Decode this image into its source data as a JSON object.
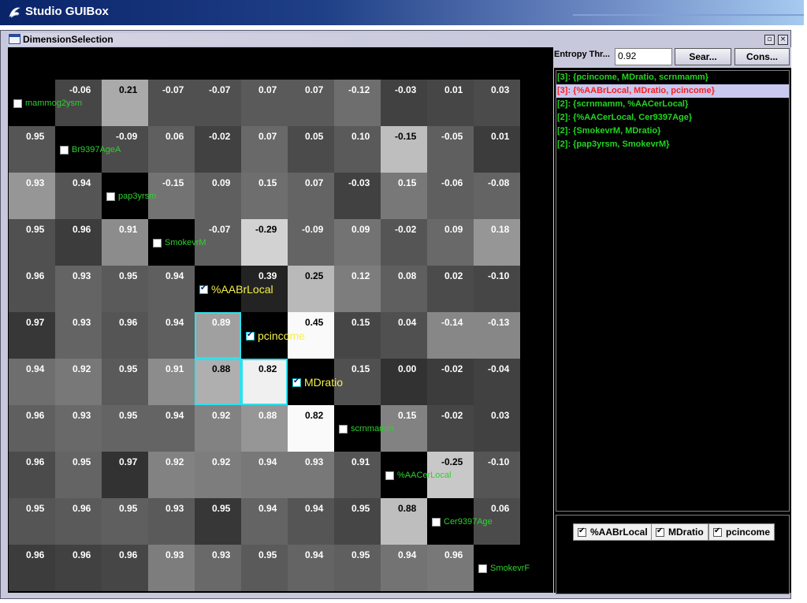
{
  "app": {
    "title": "Studio GUIBox",
    "icon": "studio-swirl-icon"
  },
  "frame": {
    "title": "DimensionSelection",
    "icon": "window-icon",
    "buttons": [
      "maximize-icon",
      "close-icon"
    ]
  },
  "matrix": {
    "dimensions": [
      {
        "name": "mammog2ysm",
        "checked": false
      },
      {
        "name": "Br9397AgeA",
        "checked": false
      },
      {
        "name": "pap3yrsm",
        "checked": false
      },
      {
        "name": "SmokevrM",
        "checked": false
      },
      {
        "name": "%AABrLocal",
        "checked": true
      },
      {
        "name": "pcincome",
        "checked": true
      },
      {
        "name": "MDratio",
        "checked": true
      },
      {
        "name": "scrnmamm",
        "checked": false
      },
      {
        "name": "%AACerLocal",
        "checked": false
      },
      {
        "name": "Cer9397Age",
        "checked": false
      },
      {
        "name": "SmokevrF",
        "checked": false
      }
    ],
    "values": [
      [
        null,
        "-0.06",
        "0.21",
        "-0.07",
        "-0.07",
        "0.07",
        "0.07",
        "-0.12",
        "-0.03",
        "0.01",
        "0.03"
      ],
      [
        "0.95",
        null,
        "-0.09",
        "0.06",
        "-0.02",
        "0.07",
        "0.05",
        "0.10",
        "-0.15",
        "-0.05",
        "0.01"
      ],
      [
        "0.93",
        "0.94",
        null,
        "-0.15",
        "0.09",
        "0.15",
        "0.07",
        "-0.03",
        "0.15",
        "-0.06",
        "-0.08"
      ],
      [
        "0.95",
        "0.96",
        "0.91",
        null,
        "-0.07",
        "-0.29",
        "-0.09",
        "0.09",
        "-0.02",
        "0.09",
        "0.18"
      ],
      [
        "0.96",
        "0.93",
        "0.95",
        "0.94",
        null,
        "0.39",
        "0.25",
        "0.12",
        "0.08",
        "0.02",
        "-0.10"
      ],
      [
        "0.97",
        "0.93",
        "0.96",
        "0.94",
        "0.89",
        null,
        "0.45",
        "0.15",
        "0.04",
        "-0.14",
        "-0.13"
      ],
      [
        "0.94",
        "0.92",
        "0.95",
        "0.91",
        "0.88",
        "0.82",
        null,
        "0.15",
        "0.00",
        "-0.02",
        "-0.04"
      ],
      [
        "0.96",
        "0.93",
        "0.95",
        "0.94",
        "0.92",
        "0.88",
        "0.82",
        null,
        "0.15",
        "-0.02",
        "0.03"
      ],
      [
        "0.96",
        "0.95",
        "0.97",
        "0.92",
        "0.92",
        "0.94",
        "0.93",
        "0.91",
        null,
        "-0.25",
        "-0.10"
      ],
      [
        "0.95",
        "0.96",
        "0.95",
        "0.93",
        "0.95",
        "0.94",
        "0.94",
        "0.95",
        "0.88",
        null,
        "0.06"
      ],
      [
        "0.96",
        "0.96",
        "0.96",
        "0.93",
        "0.93",
        "0.95",
        "0.94",
        "0.95",
        "0.94",
        "0.96",
        null
      ]
    ],
    "shades": [
      [
        null,
        70,
        170,
        80,
        80,
        90,
        90,
        110,
        65,
        70,
        75
      ],
      [
        85,
        null,
        75,
        95,
        65,
        105,
        75,
        90,
        190,
        95,
        60
      ],
      [
        150,
        85,
        null,
        115,
        95,
        110,
        100,
        65,
        120,
        95,
        100
      ],
      [
        80,
        60,
        140,
        0,
        95,
        210,
        100,
        115,
        85,
        105,
        150
      ],
      [
        80,
        100,
        90,
        95,
        null,
        35,
        185,
        125,
        95,
        75,
        70
      ],
      [
        55,
        100,
        85,
        95,
        160,
        null,
        250,
        70,
        80,
        135,
        135
      ],
      [
        110,
        120,
        90,
        140,
        175,
        240,
        null,
        80,
        50,
        60,
        65
      ],
      [
        95,
        105,
        100,
        100,
        130,
        150,
        250,
        null,
        130,
        70,
        65
      ],
      [
        75,
        100,
        50,
        130,
        125,
        120,
        120,
        85,
        null,
        200,
        85
      ],
      [
        85,
        90,
        95,
        90,
        55,
        100,
        85,
        70,
        190,
        null,
        75
      ],
      [
        60,
        65,
        70,
        125,
        105,
        90,
        100,
        95,
        115,
        120,
        null
      ]
    ],
    "highlighted_cells": [
      [
        5,
        4
      ],
      [
        6,
        4
      ],
      [
        6,
        5
      ]
    ],
    "label_color": "#2fd12f",
    "checked_label_color": "#f5f04a",
    "highlight_color": "#2ee0ee"
  },
  "right": {
    "threshold_label": "Entropy Thr...",
    "threshold_value": "0.92",
    "search_button": "Sear...",
    "cons_button": "Cons...",
    "results": [
      {
        "text": "[3]: {pcincome, MDratio, scrnmamm}",
        "selected": false
      },
      {
        "text": "[3]: {%AABrLocal, MDratio, pcincome}",
        "selected": true
      },
      {
        "text": "[2]: {scrnmamm, %AACerLocal}",
        "selected": false
      },
      {
        "text": "[2]: {%AACerLocal, Cer9397Age}",
        "selected": false
      },
      {
        "text": "[2]: {SmokevrM, MDratio}",
        "selected": false
      },
      {
        "text": "[2]: {pap3yrsm, SmokevrM}",
        "selected": false
      }
    ],
    "selected_dimensions": [
      "%AABrLocal",
      "MDratio",
      "pcincome"
    ]
  }
}
